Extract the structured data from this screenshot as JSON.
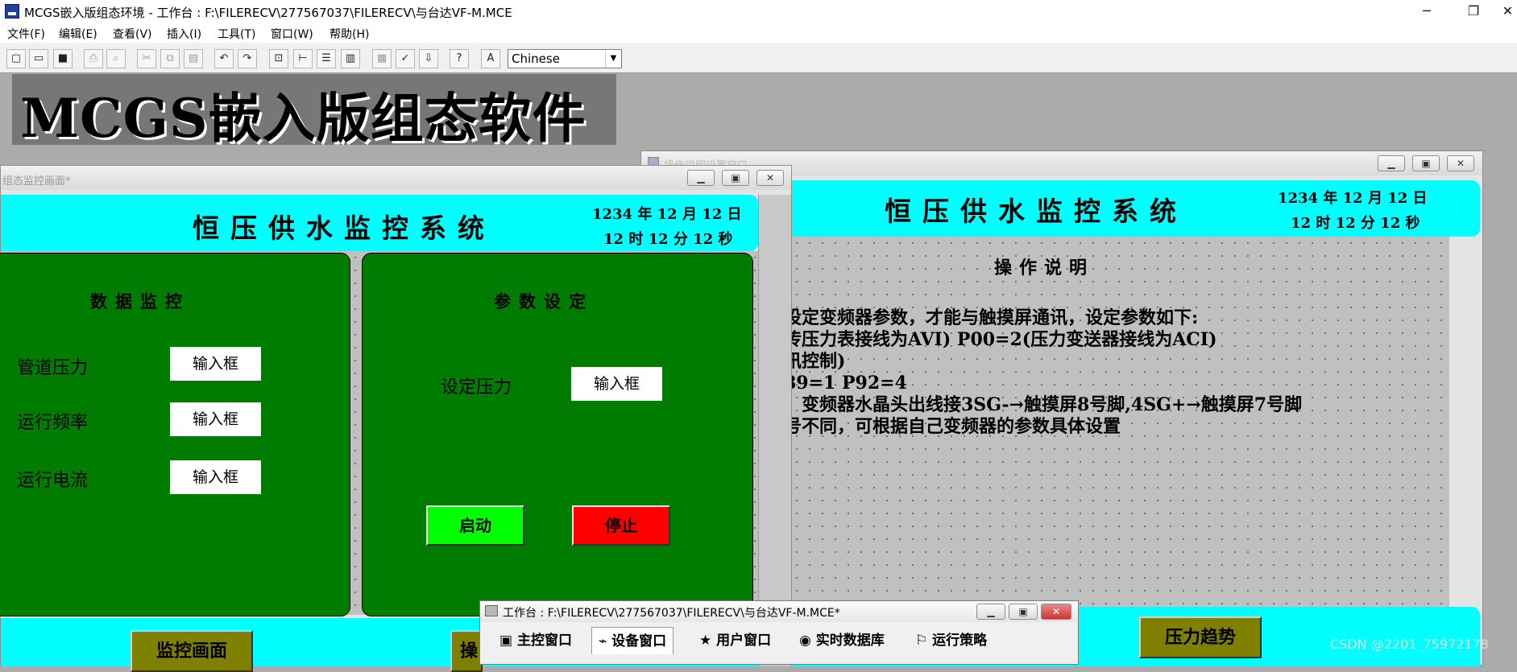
{
  "window": {
    "title": "MCGS嵌入版组态环境 - 工作台 : F:\\FILERECV\\277567037\\FILERECV\\与台达VF-M.MCE",
    "min": "─",
    "max": "❐",
    "close": "✕"
  },
  "menu": [
    "文件(F)",
    "编辑(E)",
    "查看(V)",
    "插入(I)",
    "工具(T)",
    "窗口(W)",
    "帮助(H)"
  ],
  "toolbar": {
    "language": "Chinese"
  },
  "banner": "MCGS嵌入版组态软件",
  "monitor_window": {
    "title": "组态监控画面*",
    "system_name": "恒压供水监控系统",
    "date_line": "1234 年 12 月 12 日",
    "time_line": "12 时 12 分 12 秒",
    "data_panel": {
      "title": "数据监控",
      "rows": [
        {
          "label": "管道压力",
          "box": "输入框"
        },
        {
          "label": "运行频率",
          "box": "输入框"
        },
        {
          "label": "运行电流",
          "box": "输入框"
        }
      ]
    },
    "param_panel": {
      "title": "参数设定",
      "set_label": "设定压力",
      "set_box": "输入框",
      "start": "启动",
      "stop": "停止"
    },
    "nav_button": "监控画面",
    "nav_button2_partial": "操"
  },
  "instruction_window": {
    "title": "操作说明设置窗口",
    "system_name": "恒压供水监控系统",
    "date_line": "1234 年 12 月 12 日",
    "time_line": "12 时 12 分 12 秒",
    "heading": "操作说明",
    "lines": [
      "设定变频器参数，才能与触摸屏通讯，设定参数如下:",
      "传压力表接线为AVI) P00=2(压力变送器接线为ACI)",
      "讯控制)",
      "89=1   P92=4",
      "，变频器水晶头出线接3SG-→触摸屏8号脚,4SG+→触摸屏7号脚",
      "号不同，可根据自己变频器的参数具体设置"
    ],
    "trend_button": "压力趋势"
  },
  "workbench": {
    "title": "工作台 : F:\\FILERECV\\277567037\\FILERECV\\与台达VF-M.MCE*",
    "tabs": [
      "主控窗口",
      "设备窗口",
      "用户窗口",
      "实时数据库",
      "运行策略"
    ]
  },
  "watermark": "CSDN @2201_75972178",
  "colors": {
    "cyan": "#00ffff",
    "panel_green": "#007c00",
    "start_green": "#00ff00",
    "stop_red": "#ff0000",
    "olive": "#808000"
  }
}
